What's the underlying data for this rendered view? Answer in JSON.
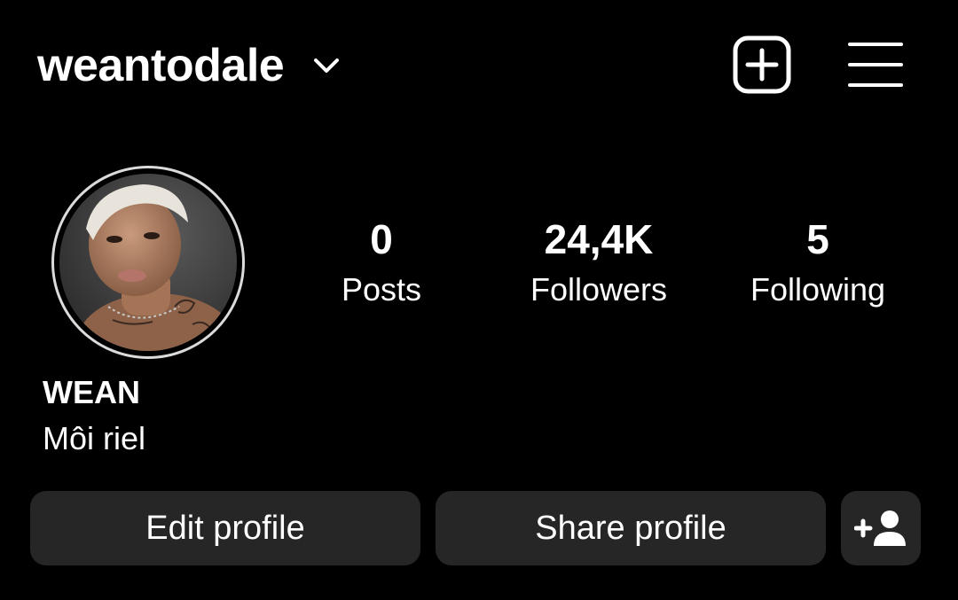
{
  "header": {
    "username": "weantodale",
    "icons": {
      "dropdown": "chevron-down-icon",
      "new_post": "plus-square-icon",
      "menu": "hamburger-menu-icon"
    }
  },
  "profile": {
    "avatar": "profile-photo",
    "display_name": "WEAN",
    "bio": "Môi riel"
  },
  "stats": {
    "posts": {
      "value": "0",
      "label": "Posts"
    },
    "followers": {
      "value": "24,4K",
      "label": "Followers"
    },
    "following": {
      "value": "5",
      "label": "Following"
    }
  },
  "actions": {
    "edit_label": "Edit profile",
    "share_label": "Share profile",
    "add_icon": "add-person-icon"
  },
  "colors": {
    "background": "#000000",
    "text": "#ffffff",
    "button_bg": "#262626",
    "avatar_ring": "#dbdbdb"
  }
}
